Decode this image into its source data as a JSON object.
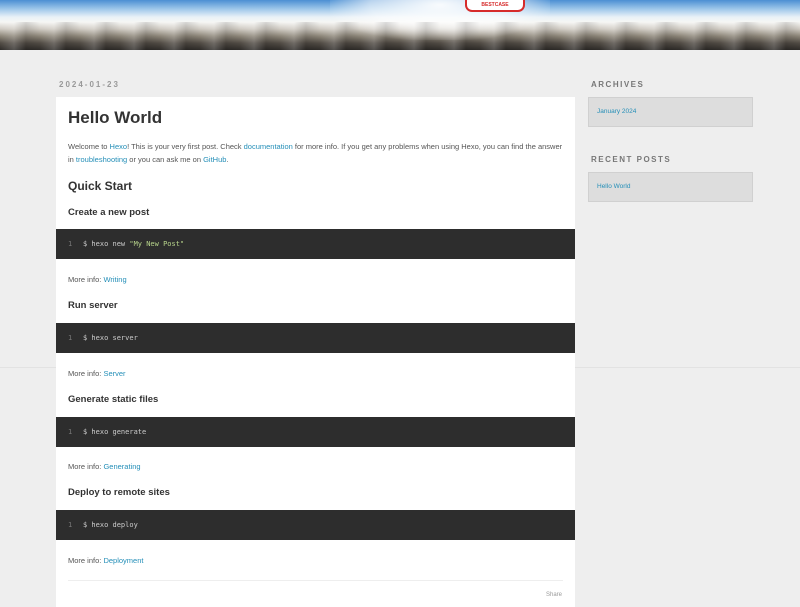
{
  "banner": {
    "badge_text": "BESTCASE"
  },
  "article": {
    "date": "2024-01-23",
    "title": "Hello World",
    "intro": {
      "p1": "Welcome to ",
      "hexo_link": "Hexo",
      "p2": "! This is your very first post. Check ",
      "docs_link": "documentation",
      "p3": " for more info. If you get any problems when using Hexo, you can find the answer in ",
      "trouble_link": "troubleshooting",
      "p4": " or you can ask me on ",
      "github_link": "GitHub",
      "p5": "."
    },
    "quick_start_heading": "Quick Start",
    "sections": [
      {
        "heading": "Create a new post",
        "line_no": "1",
        "cmd": "$ hexo new ",
        "cmd_str": "\"My New Post\"",
        "more_label": "More info: ",
        "more_link": "Writing"
      },
      {
        "heading": "Run server",
        "line_no": "1",
        "cmd": "$ hexo server",
        "cmd_str": "",
        "more_label": "More info: ",
        "more_link": "Server"
      },
      {
        "heading": "Generate static files",
        "line_no": "1",
        "cmd": "$ hexo generate",
        "cmd_str": "",
        "more_label": "More info: ",
        "more_link": "Generating"
      },
      {
        "heading": "Deploy to remote sites",
        "line_no": "1",
        "cmd": "$ hexo deploy",
        "cmd_str": "",
        "more_label": "More info: ",
        "more_link": "Deployment"
      }
    ],
    "share_label": "Share"
  },
  "sidebar": {
    "archives_title": "ARCHIVES",
    "archives_item": "January 2024",
    "recent_title": "RECENT POSTS",
    "recent_item": "Hello World"
  },
  "colors": {
    "link": "#258fb8",
    "code_bg": "#2d2d2d",
    "page_bg": "#eeeeee"
  }
}
